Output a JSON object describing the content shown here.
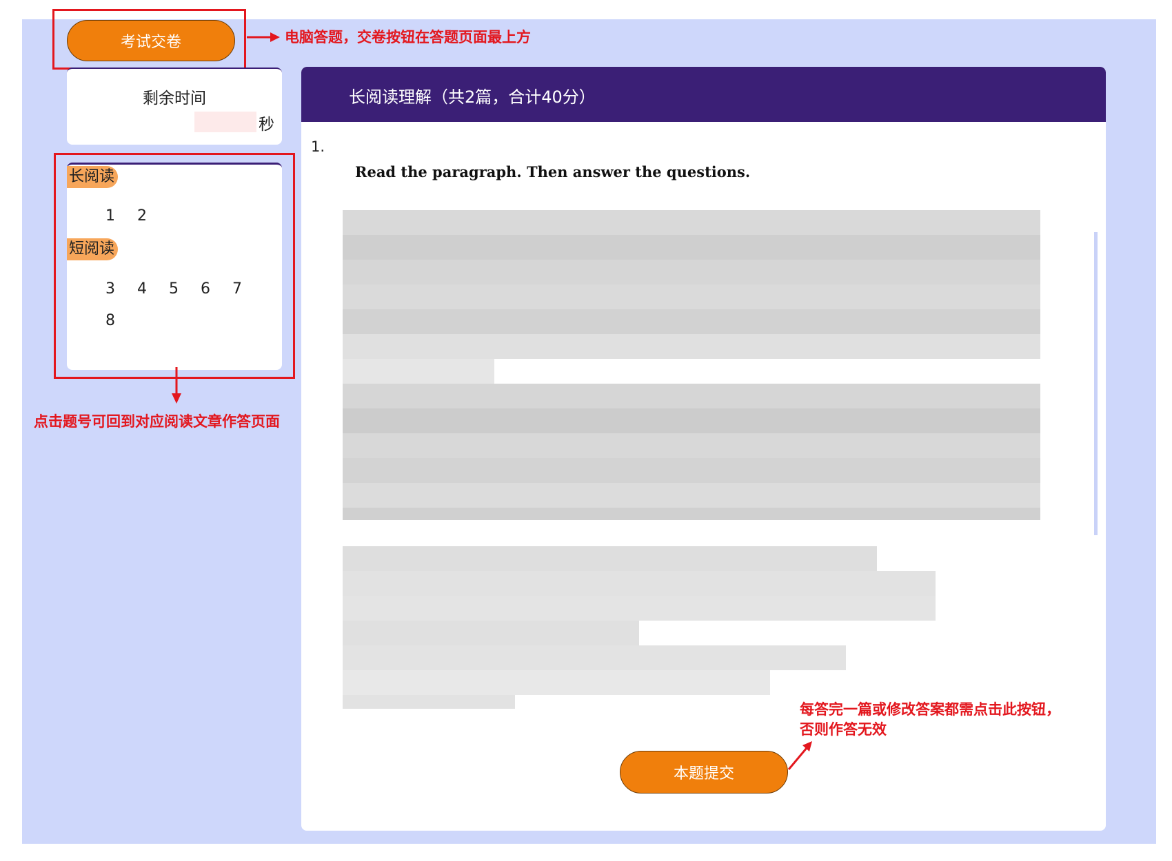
{
  "toolbar": {
    "submit_exam_label": "考试交卷"
  },
  "annotations": {
    "top_note": "电脑答题，交卷按钮在答题页面最上方",
    "nav_note": "点击题号可回到对应阅读文章作答页面",
    "submit_note_line1": "每答完一篇或修改答案都需点击此按钮，",
    "submit_note_line2": "否则作答无效"
  },
  "timer": {
    "label": "剩余时间",
    "unit": "秒"
  },
  "navigator": {
    "sections": [
      {
        "label": "长阅读",
        "questions": [
          "1",
          "2"
        ]
      },
      {
        "label": "短阅读",
        "questions": [
          "3",
          "4",
          "5",
          "6",
          "7",
          "8"
        ]
      }
    ]
  },
  "main": {
    "title": "长阅读理解（共2篇，合计40分）",
    "question_number": "1.",
    "instruction": "Read the paragraph. Then answer the questions.",
    "submit_question_label": "本题提交"
  },
  "colors": {
    "accent_orange": "#f07f0c",
    "header_purple": "#3b1f76",
    "background_lavender": "#ced7fb",
    "annotation_red": "#e3171e",
    "tag_orange": "#f7a65a"
  }
}
